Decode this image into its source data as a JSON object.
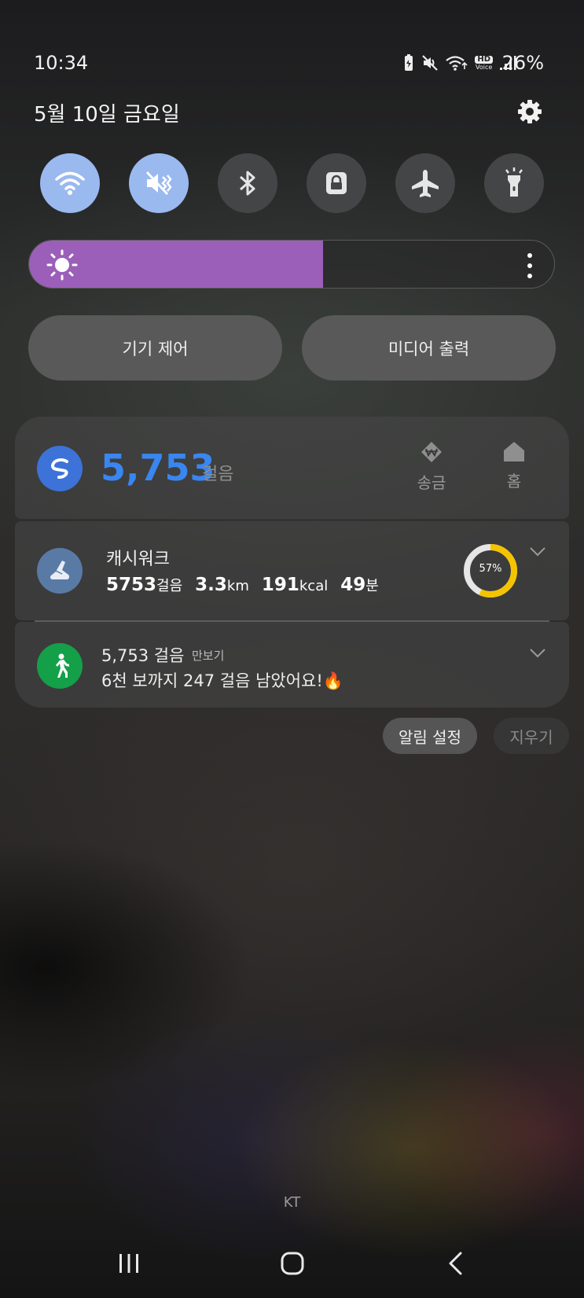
{
  "status_bar": {
    "time": "10:34",
    "battery_percent": "26%",
    "icons": [
      "battery-saver-icon",
      "mute-icon",
      "wifi-calling-icon",
      "hd-voice-icon",
      "signal-icon"
    ],
    "hd_label": "HD",
    "voice_label": "Voice"
  },
  "header": {
    "date": "5월 10일 금요일",
    "settings_icon": "gear-icon"
  },
  "quick_toggles": [
    {
      "name": "wifi",
      "icon": "wifi-icon",
      "state": "on"
    },
    {
      "name": "sound",
      "icon": "mute-icon",
      "state": "on"
    },
    {
      "name": "bluetooth",
      "icon": "bluetooth-icon",
      "state": "off"
    },
    {
      "name": "rotation-lock",
      "icon": "lock-icon",
      "state": "off"
    },
    {
      "name": "airplane-mode",
      "icon": "airplane-icon",
      "state": "off"
    },
    {
      "name": "flashlight",
      "icon": "flashlight-icon",
      "state": "off"
    }
  ],
  "brightness": {
    "level": 0.56,
    "color": "#9b5fb9"
  },
  "panel_buttons": {
    "device_control": "기기 제어",
    "media_output": "미디어 출력"
  },
  "toss_card": {
    "steps": "5,753",
    "steps_unit": "걸음",
    "transfer_label": "송금",
    "home_label": "홈",
    "accent": "#3a86f0"
  },
  "cashwalk": {
    "title": "캐시워크",
    "steps": "5753",
    "steps_unit": "걸음",
    "distance": "3.3",
    "distance_unit": "km",
    "calories": "191",
    "calories_unit": "kcal",
    "minutes": "49",
    "minutes_unit": "분",
    "progress_label": "57%",
    "progress": 0.57,
    "progress_color": "#f5c400"
  },
  "pedometer": {
    "title": "5,753 걸음",
    "app_name": "만보기",
    "message": "6천 보까지 247 걸음 남았어요!",
    "emoji": "🔥"
  },
  "actions": {
    "notification_settings": "알림 설정",
    "clear": "지우기"
  },
  "carrier": "KT",
  "nav_bar": [
    "recent-apps-icon",
    "home-icon",
    "back-icon"
  ]
}
